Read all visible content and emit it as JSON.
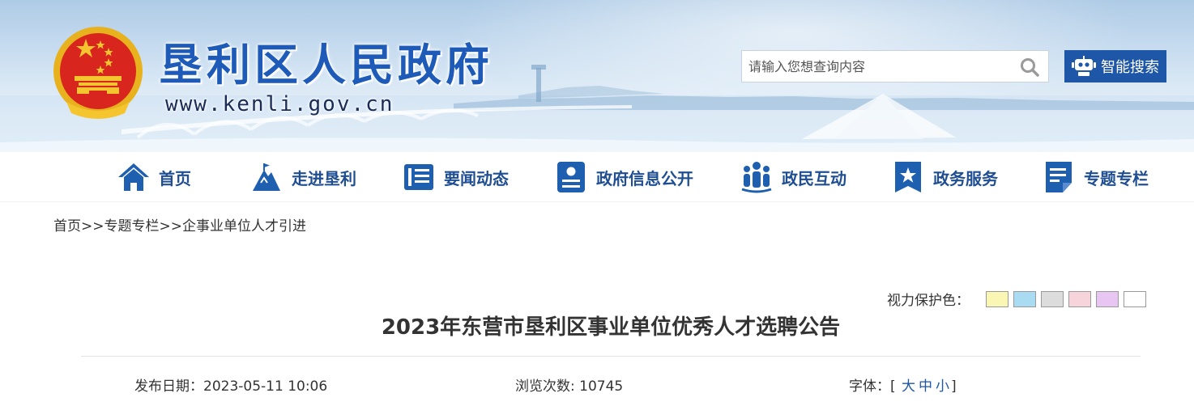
{
  "header": {
    "site_title": "垦利区人民政府",
    "site_url": "www.kenli.gov.cn",
    "emblem_icon": "national-emblem-icon",
    "search_placeholder": "请输入您想查询内容",
    "smart_search_label": "智能搜索"
  },
  "nav": {
    "items": [
      {
        "label": "首页",
        "icon": "home-icon"
      },
      {
        "label": "走进垦利",
        "icon": "mountain-icon"
      },
      {
        "label": "要闻动态",
        "icon": "news-icon"
      },
      {
        "label": "政府信息公开",
        "icon": "info-card-icon"
      },
      {
        "label": "政民互动",
        "icon": "people-icon"
      },
      {
        "label": "政务服务",
        "icon": "star-bookmark-icon"
      },
      {
        "label": "专题专栏",
        "icon": "document-icon"
      }
    ]
  },
  "breadcrumb": {
    "items": [
      "首页",
      "专题专栏",
      "企事业单位人才引进"
    ],
    "separator": ">>"
  },
  "eye_protect": {
    "label": "视力保护色：",
    "colors": [
      "#faf7b4",
      "#a9dcf2",
      "#dcdcdc",
      "#f7d3dc",
      "#e8c6f2",
      "#ffffff"
    ]
  },
  "article": {
    "title": "2023年东营市垦利区事业单位优秀人才选聘公告",
    "date_label": "发布日期：",
    "date_value": "2023-05-11 10:06",
    "views_label": "浏览次数: ",
    "views_value": "10745",
    "font_label": "字体：",
    "font_open": "[",
    "font_sizes": [
      "大",
      "中",
      "小"
    ],
    "font_close": "]"
  },
  "colors": {
    "brand_blue": "#1e56a8",
    "nav_text": "#1f4e92"
  }
}
